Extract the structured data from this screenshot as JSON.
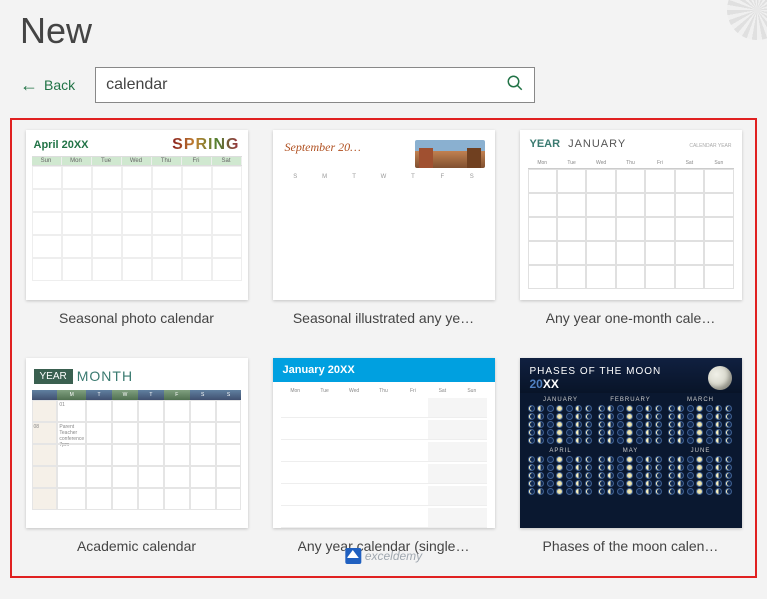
{
  "header": {
    "title": "New"
  },
  "back": {
    "label": "Back"
  },
  "search": {
    "value": "calendar"
  },
  "days_short": [
    "Sunday",
    "Monday",
    "Tuesday",
    "Wednesday",
    "Thursday",
    "Friday",
    "Saturday"
  ],
  "days_ini": [
    "S",
    "M",
    "T",
    "W",
    "T",
    "F",
    "S"
  ],
  "templates": [
    {
      "label": "Seasonal photo calendar",
      "thumb_title": "April 20XX",
      "thumb_deco": "SPRING"
    },
    {
      "label": "Seasonal illustrated any ye…",
      "thumb_title": "September 20…"
    },
    {
      "label": "Any year one-month cale…",
      "thumb_year": "YEAR",
      "thumb_month": "JANUARY"
    },
    {
      "label": "Academic calendar",
      "thumb_year": "YEAR",
      "thumb_month": "MONTH"
    },
    {
      "label": "Any year calendar (single…",
      "thumb_title": "January 20XX"
    },
    {
      "label": "Phases of the moon calen…",
      "thumb_title": "PHASES OF THE MOON",
      "thumb_year_prefix": "20",
      "thumb_year_suffix": "XX",
      "months": [
        "JANUARY",
        "FEBRUARY",
        "MARCH",
        "APRIL",
        "MAY",
        "JUNE"
      ]
    }
  ],
  "watermark": "exceldemy"
}
